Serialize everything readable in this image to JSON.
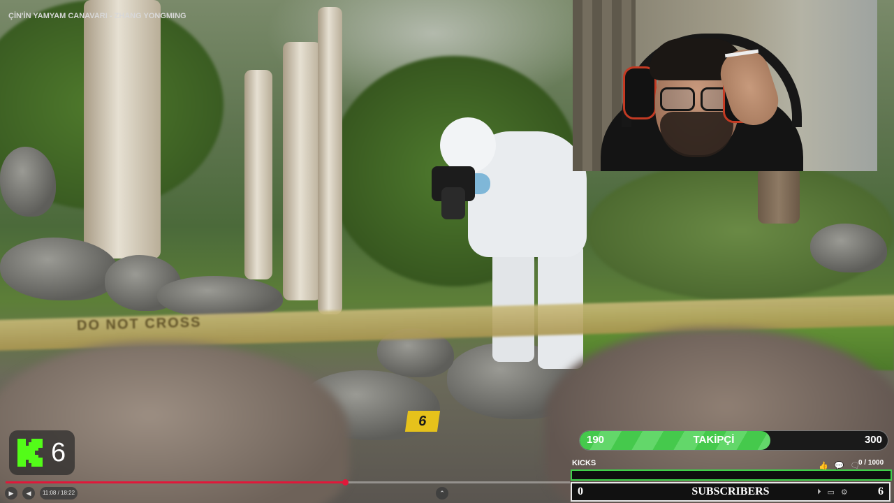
{
  "video": {
    "title": "ÇİN'İN YAMYAM CANAVARI - ZHANG YONGMING",
    "tape_text": "DO NOT CROSS",
    "evidence_marker": "6",
    "progress": 0.6017,
    "current_time": "11:08",
    "duration": "18:22",
    "time_display": "11:08 / 18:22"
  },
  "kick_badge": {
    "count": "6",
    "logo_color": "#53fc18"
  },
  "follower_goal": {
    "start": "190",
    "label": "TAKİPÇİ",
    "goal": "300",
    "progress": 0.62,
    "color": "#45c94c"
  },
  "kicks_goal": {
    "label": "KICKS",
    "count": "0 / 1000",
    "progress": 0,
    "color": "#3fcf4a"
  },
  "subscriber_goal": {
    "start": "0",
    "label": "SUBSCRIBERS",
    "goal": "6"
  },
  "controls": {
    "play_icon": "play-icon",
    "volume_icon": "volume-icon",
    "expand_icon": "chevron-up-icon"
  }
}
